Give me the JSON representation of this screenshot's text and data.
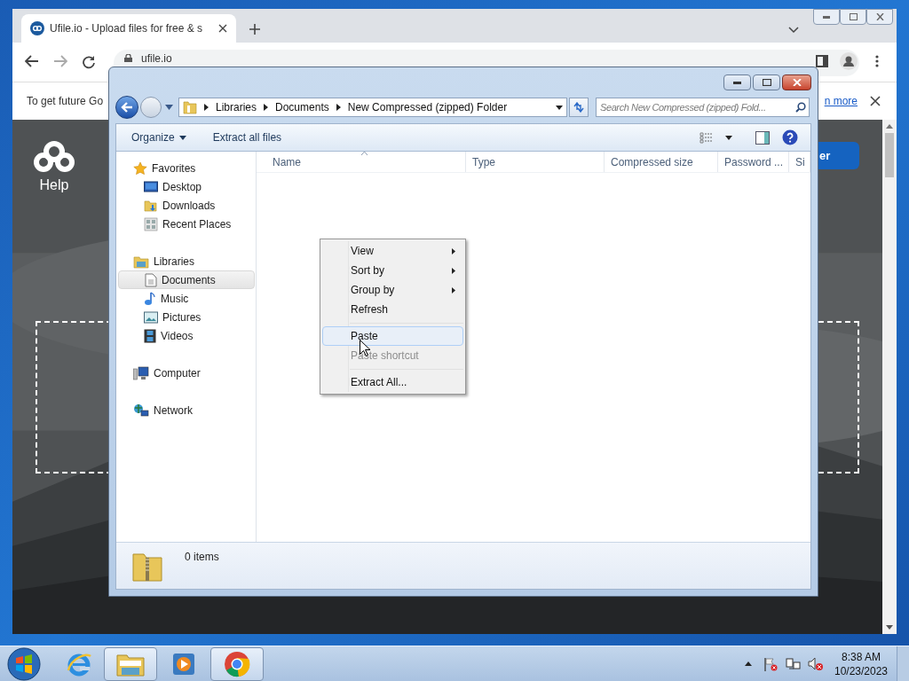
{
  "browser": {
    "tab": {
      "title": "Ufile.io - Upload files for free & s"
    },
    "address": "ufile.io",
    "infobar": {
      "text": "To get future Go",
      "link": "n more"
    },
    "page": {
      "logo_label": "Help",
      "button_text": "er"
    }
  },
  "explorer": {
    "breadcrumb": [
      "Libraries",
      "Documents",
      "New Compressed (zipped) Folder"
    ],
    "search_placeholder": "Search New Compressed (zipped) Fold...",
    "toolbar": [
      {
        "label": "Organize",
        "dropdown": true
      },
      {
        "label": "Extract all files",
        "dropdown": false
      }
    ],
    "sidebar": [
      {
        "label": "Favorites",
        "kind": "star",
        "selected": false,
        "children": [
          {
            "label": "Desktop",
            "kind": "desktop",
            "selected": false
          },
          {
            "label": "Downloads",
            "kind": "downloads",
            "selected": false
          },
          {
            "label": "Recent Places",
            "kind": "recent",
            "selected": false
          }
        ]
      },
      {
        "label": "Libraries",
        "kind": "libraries",
        "selected": false,
        "children": [
          {
            "label": "Documents",
            "kind": "document",
            "selected": true
          },
          {
            "label": "Music",
            "kind": "music",
            "selected": false
          },
          {
            "label": "Pictures",
            "kind": "pictures",
            "selected": false
          },
          {
            "label": "Videos",
            "kind": "videos",
            "selected": false
          }
        ]
      },
      {
        "label": "Computer",
        "kind": "computer",
        "selected": false
      },
      {
        "label": "Network",
        "kind": "network",
        "selected": false
      }
    ],
    "columns": [
      {
        "label": "Name",
        "sorted": true
      },
      {
        "label": "Type",
        "sorted": false
      },
      {
        "label": "Compressed size",
        "sorted": false
      },
      {
        "label": "Password ...",
        "sorted": false
      },
      {
        "label": "Si",
        "sorted": false
      }
    ],
    "status": "0 items"
  },
  "context_menu": [
    {
      "kind": "item",
      "label": "View",
      "submenu": true,
      "selected": false,
      "disabled": false
    },
    {
      "kind": "item",
      "label": "Sort by",
      "submenu": true,
      "selected": false,
      "disabled": false
    },
    {
      "kind": "item",
      "label": "Group by",
      "submenu": true,
      "selected": false,
      "disabled": false
    },
    {
      "kind": "item",
      "label": "Refresh",
      "submenu": false,
      "selected": false,
      "disabled": false
    },
    {
      "kind": "separator"
    },
    {
      "kind": "item",
      "label": "Paste",
      "submenu": false,
      "selected": true,
      "disabled": false
    },
    {
      "kind": "item",
      "label": "Paste shortcut",
      "submenu": false,
      "selected": false,
      "disabled": true
    },
    {
      "kind": "separator"
    },
    {
      "kind": "item",
      "label": "Extract All...",
      "submenu": false,
      "selected": false,
      "disabled": false
    }
  ],
  "taskbar": {
    "apps": [
      {
        "kind": "ie",
        "open": false
      },
      {
        "kind": "explorer",
        "open": true
      },
      {
        "kind": "media",
        "open": false
      },
      {
        "kind": "chrome",
        "open": true
      }
    ],
    "time": "8:38 AM",
    "date": "10/23/2023"
  }
}
